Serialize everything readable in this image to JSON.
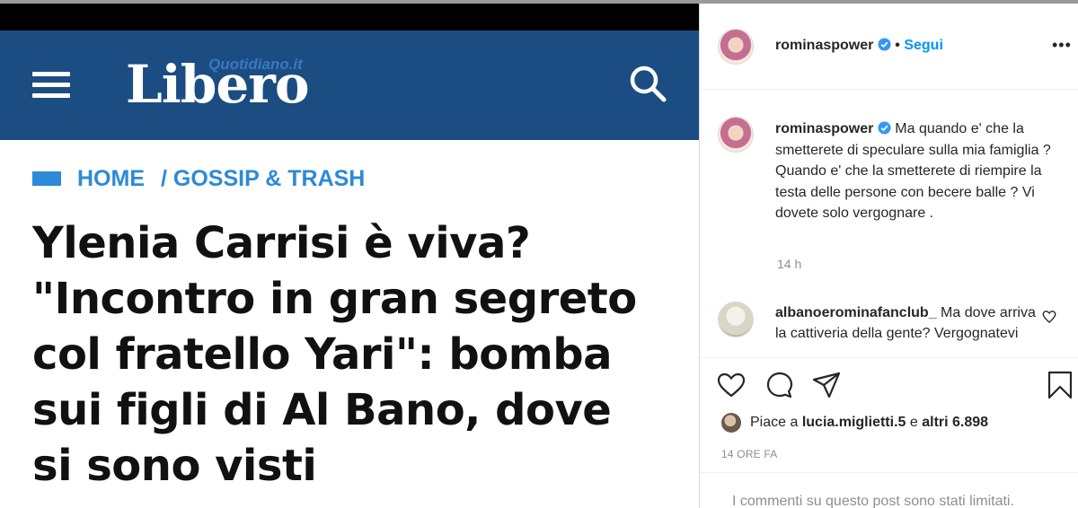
{
  "article": {
    "logo_main": "Libero",
    "logo_sub": "Quotidiano.it",
    "breadcrumb_home": "HOME",
    "breadcrumb_section": "/ GOSSIP & TRASH",
    "headline_lines": [
      "Ylenia Carrisi è viva?",
      "\"Incontro in gran segreto",
      "col fratello Yari\": bomba",
      "sui figli di Al Bano, dove",
      "si sono visti"
    ]
  },
  "instagram": {
    "username": "rominaspower",
    "follow_label": "Segui",
    "separator": "•",
    "caption_user": "rominaspower",
    "caption_text": "Ma quando e' che la smetterete di speculare sulla mia famiglia ? Quando e' che la smetterete di riempire la testa delle persone con becere balle ? Vi dovete solo vergognare .",
    "caption_time": "14 h",
    "comment_user": "albanoerominafanclub_",
    "comment_text": "Ma dove arriva la cattiveria della gente? Vergognatevi",
    "likes_prefix": "Piace a",
    "likes_user": "lucia.miglietti.5",
    "likes_middle": "e",
    "likes_count": "altri 6.898",
    "post_time": "14 ORE FA",
    "comments_limited": "I commenti su questo post sono stati limitati."
  },
  "colors": {
    "libero_blue": "#1b4d82",
    "breadcrumb_blue": "#2d8ad6",
    "ig_link_blue": "#0095f6",
    "ig_text": "#262626",
    "ig_muted": "#8e8e8e"
  },
  "icons": [
    "menu-icon",
    "search-icon",
    "verified-icon",
    "more-options-icon",
    "heart-icon",
    "comment-icon",
    "share-icon",
    "bookmark-icon"
  ]
}
